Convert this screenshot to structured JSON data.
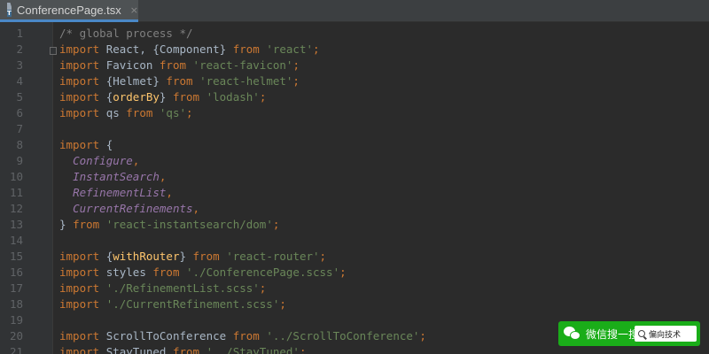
{
  "tab": {
    "filename": "ConferencePage.tsx",
    "icon_badge": "TSX",
    "close_glyph": "×"
  },
  "editor": {
    "line_numbers": [
      "1",
      "2",
      "3",
      "4",
      "5",
      "6",
      "7",
      "8",
      "9",
      "10",
      "11",
      "12",
      "13",
      "14",
      "15",
      "16",
      "17",
      "18",
      "19",
      "20",
      "21"
    ],
    "lines": [
      [
        {
          "t": "c",
          "v": "/* global process */"
        }
      ],
      [
        {
          "t": "k",
          "v": "import "
        },
        {
          "t": "p",
          "v": "React, {Component} "
        },
        {
          "t": "k",
          "v": "from "
        },
        {
          "t": "s",
          "v": "'react'"
        },
        {
          "t": "k",
          "v": ";"
        }
      ],
      [
        {
          "t": "k",
          "v": "import "
        },
        {
          "t": "p",
          "v": "Favicon "
        },
        {
          "t": "k",
          "v": "from "
        },
        {
          "t": "s",
          "v": "'react-favicon'"
        },
        {
          "t": "k",
          "v": ";"
        }
      ],
      [
        {
          "t": "k",
          "v": "import "
        },
        {
          "t": "p",
          "v": "{Helmet} "
        },
        {
          "t": "k",
          "v": "from "
        },
        {
          "t": "s",
          "v": "'react-helmet'"
        },
        {
          "t": "k",
          "v": ";"
        }
      ],
      [
        {
          "t": "k",
          "v": "import "
        },
        {
          "t": "p",
          "v": "{"
        },
        {
          "t": "f",
          "v": "orderBy"
        },
        {
          "t": "p",
          "v": "} "
        },
        {
          "t": "k",
          "v": "from "
        },
        {
          "t": "s",
          "v": "'lodash'"
        },
        {
          "t": "k",
          "v": ";"
        }
      ],
      [
        {
          "t": "k",
          "v": "import "
        },
        {
          "t": "p",
          "v": "qs "
        },
        {
          "t": "k",
          "v": "from "
        },
        {
          "t": "s",
          "v": "'qs'"
        },
        {
          "t": "k",
          "v": ";"
        }
      ],
      [],
      [
        {
          "t": "k",
          "v": "import "
        },
        {
          "t": "p",
          "v": "{"
        }
      ],
      [
        {
          "t": "p",
          "v": "  "
        },
        {
          "t": "i",
          "v": "Configure"
        },
        {
          "t": "k",
          "v": ","
        }
      ],
      [
        {
          "t": "p",
          "v": "  "
        },
        {
          "t": "i",
          "v": "InstantSearch"
        },
        {
          "t": "k",
          "v": ","
        }
      ],
      [
        {
          "t": "p",
          "v": "  "
        },
        {
          "t": "i",
          "v": "RefinementList"
        },
        {
          "t": "k",
          "v": ","
        }
      ],
      [
        {
          "t": "p",
          "v": "  "
        },
        {
          "t": "i",
          "v": "CurrentRefinements"
        },
        {
          "t": "k",
          "v": ","
        }
      ],
      [
        {
          "t": "p",
          "v": "} "
        },
        {
          "t": "k",
          "v": "from "
        },
        {
          "t": "s",
          "v": "'react-instantsearch/dom'"
        },
        {
          "t": "k",
          "v": ";"
        }
      ],
      [],
      [
        {
          "t": "k",
          "v": "import "
        },
        {
          "t": "p",
          "v": "{"
        },
        {
          "t": "f",
          "v": "withRouter"
        },
        {
          "t": "p",
          "v": "} "
        },
        {
          "t": "k",
          "v": "from "
        },
        {
          "t": "s",
          "v": "'react-router'"
        },
        {
          "t": "k",
          "v": ";"
        }
      ],
      [
        {
          "t": "k",
          "v": "import "
        },
        {
          "t": "p",
          "v": "styles "
        },
        {
          "t": "k",
          "v": "from "
        },
        {
          "t": "s",
          "v": "'./ConferencePage.scss'"
        },
        {
          "t": "k",
          "v": ";"
        }
      ],
      [
        {
          "t": "k",
          "v": "import "
        },
        {
          "t": "s",
          "v": "'./RefinementList.scss'"
        },
        {
          "t": "k",
          "v": ";"
        }
      ],
      [
        {
          "t": "k",
          "v": "import "
        },
        {
          "t": "s",
          "v": "'./CurrentRefinement.scss'"
        },
        {
          "t": "k",
          "v": ";"
        }
      ],
      [],
      [
        {
          "t": "k",
          "v": "import "
        },
        {
          "t": "p",
          "v": "ScrollToConference "
        },
        {
          "t": "k",
          "v": "from "
        },
        {
          "t": "s",
          "v": "'../ScrollToConference'"
        },
        {
          "t": "k",
          "v": ";"
        }
      ],
      [
        {
          "t": "k",
          "v": "import "
        },
        {
          "t": "p",
          "v": "StayTuned "
        },
        {
          "t": "k",
          "v": "from "
        },
        {
          "t": "s",
          "v": "'../StayTuned'"
        },
        {
          "t": "k",
          "v": ";"
        }
      ]
    ]
  },
  "colors": {
    "keyword": "#cc7832",
    "string": "#6a8759",
    "comment": "#808080",
    "plain": "#a9b7c6",
    "function": "#ffc66d",
    "member": "#9876aa",
    "background": "#2b2b2b",
    "gutter": "#313335",
    "wechat_green": "#1aad19"
  },
  "watermark": {
    "label": "微信搜一搜",
    "search_text": "偏向技术",
    "icon": "wechat-icon"
  }
}
